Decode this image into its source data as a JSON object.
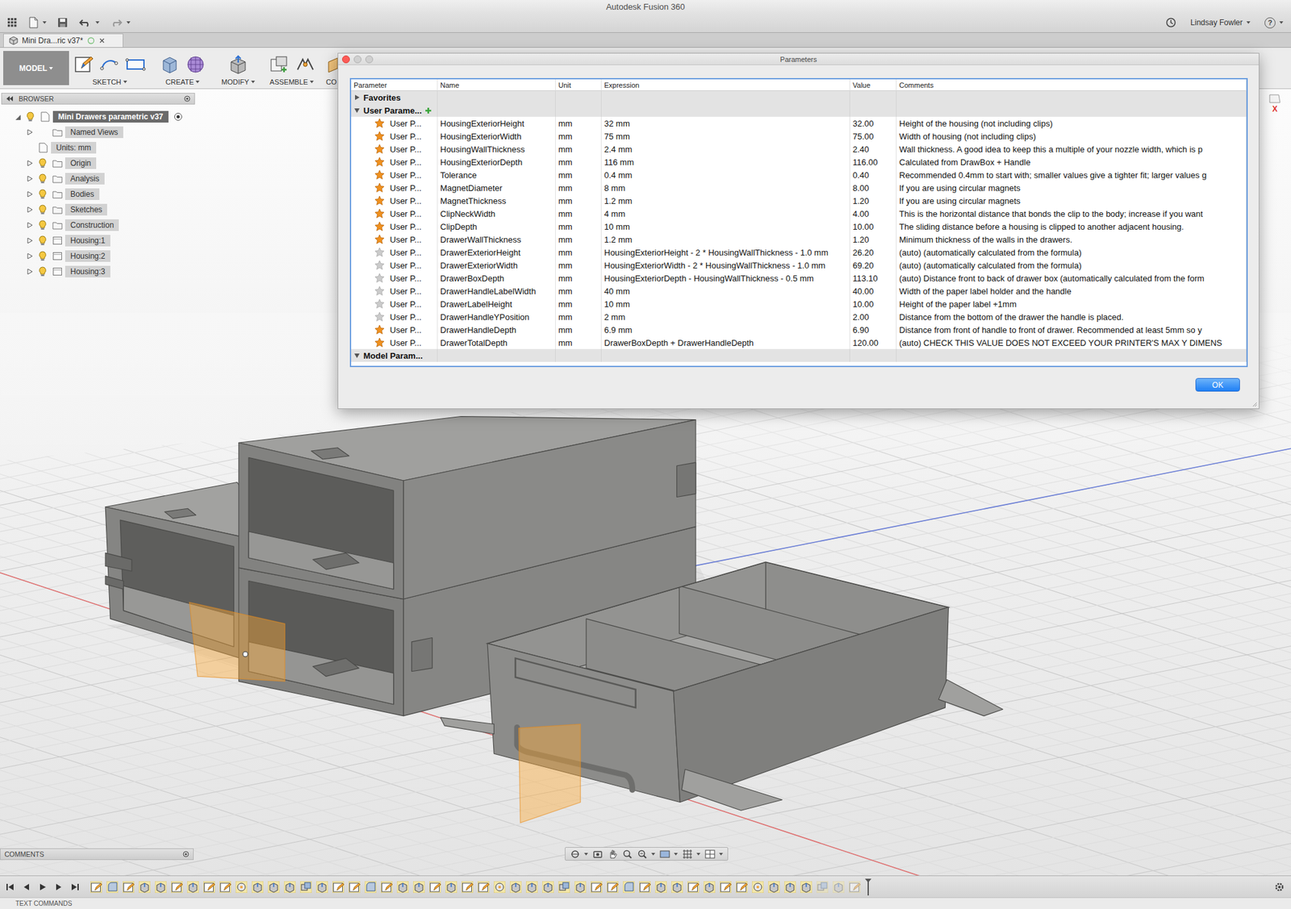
{
  "window": {
    "title": "Autodesk Fusion 360"
  },
  "app_bar": {
    "user": "Lindsay Fowler",
    "help": "?"
  },
  "document_tab": {
    "label": "Mini Dra...ric v37*",
    "selected": true
  },
  "toolbar": {
    "groups": [
      {
        "label": "MODEL",
        "kind": "workspace",
        "dropdown": true,
        "selected": true
      },
      {
        "label": "SKETCH",
        "kind": "sketch",
        "dropdown": true,
        "selected": false
      },
      {
        "label": "CREATE",
        "kind": "create",
        "dropdown": true,
        "selected": false
      },
      {
        "label": "MODIFY",
        "kind": "modify",
        "dropdown": true,
        "selected": false
      },
      {
        "label": "ASSEMBLE",
        "kind": "assemble",
        "dropdown": true,
        "selected": false
      },
      {
        "label": "CO",
        "kind": "construct",
        "dropdown": false,
        "selected": false
      }
    ]
  },
  "browser": {
    "title": "BROWSER",
    "items": [
      {
        "label": "Mini Drawers parametric v37",
        "kind": "root",
        "level": 0,
        "expandable": true,
        "expanded": true,
        "visible": true,
        "selected": true
      },
      {
        "label": "Named Views",
        "kind": "views",
        "level": 1,
        "expandable": true,
        "expanded": false,
        "selected": false
      },
      {
        "label": "Units: mm",
        "kind": "units",
        "level": 1,
        "expandable": false,
        "selected": false
      },
      {
        "label": "Origin",
        "kind": "folder",
        "level": 1,
        "expandable": true,
        "expanded": false,
        "visible": true,
        "selected": false
      },
      {
        "label": "Analysis",
        "kind": "folder",
        "level": 1,
        "expandable": true,
        "expanded": false,
        "visible": true,
        "selected": false
      },
      {
        "label": "Bodies",
        "kind": "folder",
        "level": 1,
        "expandable": true,
        "expanded": false,
        "visible": true,
        "selected": false
      },
      {
        "label": "Sketches",
        "kind": "folder",
        "level": 1,
        "expandable": true,
        "expanded": false,
        "visible": true,
        "selected": false
      },
      {
        "label": "Construction",
        "kind": "folder",
        "level": 1,
        "expandable": true,
        "expanded": false,
        "visible": true,
        "selected": false
      },
      {
        "label": "Housing:1",
        "kind": "component",
        "level": 1,
        "expandable": true,
        "expanded": false,
        "visible": true,
        "selected": false
      },
      {
        "label": "Housing:2",
        "kind": "component",
        "level": 1,
        "expandable": true,
        "expanded": false,
        "visible": true,
        "selected": false
      },
      {
        "label": "Housing:3",
        "kind": "component",
        "level": 1,
        "expandable": true,
        "expanded": false,
        "visible": true,
        "selected": false
      }
    ]
  },
  "viewcube": {
    "axis": "X"
  },
  "dialog": {
    "title": "Parameters",
    "columns": [
      "Parameter",
      "Name",
      "Unit",
      "Expression",
      "Value",
      "Comments"
    ],
    "groups": [
      {
        "label": "Favorites",
        "expanded": false,
        "add_button": false,
        "rows": []
      },
      {
        "label": "User Parame...",
        "expanded": true,
        "add_button": true,
        "rows": [
          {
            "type": "User P...",
            "name": "HousingExteriorHeight",
            "unit": "mm",
            "expression": "32 mm",
            "value": "32.00",
            "comment": "Height of the housing (not including clips)",
            "favorite": true
          },
          {
            "type": "User P...",
            "name": "HousingExteriorWidth",
            "unit": "mm",
            "expression": "75 mm",
            "value": "75.00",
            "comment": "Width of housing (not including clips)",
            "favorite": true
          },
          {
            "type": "User P...",
            "name": "HousingWallThickness",
            "unit": "mm",
            "expression": "2.4 mm",
            "value": "2.40",
            "comment": "Wall thickness. A good idea to keep this a multiple of your nozzle width, which is p",
            "favorite": true
          },
          {
            "type": "User P...",
            "name": "HousingExteriorDepth",
            "unit": "mm",
            "expression": "116 mm",
            "value": "116.00",
            "comment": "Calculated from DrawBox + Handle",
            "favorite": true
          },
          {
            "type": "User P...",
            "name": "Tolerance",
            "unit": "mm",
            "expression": "0.4 mm",
            "value": "0.40",
            "comment": "Recommended 0.4mm to start with; smaller values give a tighter fit; larger values g",
            "favorite": true
          },
          {
            "type": "User P...",
            "name": "MagnetDiameter",
            "unit": "mm",
            "expression": "8 mm",
            "value": "8.00",
            "comment": "If you are using circular magnets",
            "favorite": true
          },
          {
            "type": "User P...",
            "name": "MagnetThickness",
            "unit": "mm",
            "expression": "1.2 mm",
            "value": "1.20",
            "comment": "If you are using circular magnets",
            "favorite": true
          },
          {
            "type": "User P...",
            "name": "ClipNeckWidth",
            "unit": "mm",
            "expression": "4 mm",
            "value": "4.00",
            "comment": "This is the horizontal distance that bonds the clip to the body; increase if you want",
            "favorite": true
          },
          {
            "type": "User P...",
            "name": "ClipDepth",
            "unit": "mm",
            "expression": "10 mm",
            "value": "10.00",
            "comment": "The sliding distance before a housing is clipped to another adjacent housing.",
            "favorite": true
          },
          {
            "type": "User P...",
            "name": "DrawerWallThickness",
            "unit": "mm",
            "expression": "1.2 mm",
            "value": "1.20",
            "comment": "Minimum thickness of the walls in the drawers.",
            "favorite": true
          },
          {
            "type": "User P...",
            "name": "DrawerExteriorHeight",
            "unit": "mm",
            "expression": "HousingExteriorHeight - 2 * HousingWallThickness - 1.0 mm",
            "value": "26.20",
            "comment": "(auto) (automatically calculated from the formula)",
            "favorite": false
          },
          {
            "type": "User P...",
            "name": "DrawerExteriorWidth",
            "unit": "mm",
            "expression": "HousingExteriorWidth - 2 * HousingWallThickness - 1.0 mm",
            "value": "69.20",
            "comment": "(auto) (automatically calculated from the formula)",
            "favorite": false
          },
          {
            "type": "User P...",
            "name": "DrawerBoxDepth",
            "unit": "mm",
            "expression": "HousingExteriorDepth - HousingWallThickness - 0.5 mm",
            "value": "113.10",
            "comment": "(auto) Distance front to back of drawer box (automatically calculated from the form",
            "favorite": false
          },
          {
            "type": "User P...",
            "name": "DrawerHandleLabelWidth",
            "unit": "mm",
            "expression": "40 mm",
            "value": "40.00",
            "comment": "Width of the paper label holder and the handle",
            "favorite": false
          },
          {
            "type": "User P...",
            "name": "DrawerLabelHeight",
            "unit": "mm",
            "expression": "10 mm",
            "value": "10.00",
            "comment": "Height of the paper label +1mm",
            "favorite": false
          },
          {
            "type": "User P...",
            "name": "DrawerHandleYPosition",
            "unit": "mm",
            "expression": "2 mm",
            "value": "2.00",
            "comment": "Distance from the bottom of the drawer the handle is placed.",
            "favorite": false
          },
          {
            "type": "User P...",
            "name": "DrawerHandleDepth",
            "unit": "mm",
            "expression": "6.9 mm",
            "value": "6.90",
            "comment": "Distance from front of handle to front of drawer. Recommended at least 5mm so y",
            "favorite": true
          },
          {
            "type": "User P...",
            "name": "DrawerTotalDepth",
            "unit": "mm",
            "expression": "DrawerBoxDepth + DrawerHandleDepth",
            "value": "120.00",
            "comment": "(auto) CHECK THIS VALUE DOES NOT EXCEED YOUR PRINTER'S MAX Y DIMENS",
            "favorite": true
          }
        ]
      },
      {
        "label": "Model Param...",
        "expanded": true,
        "add_button": false,
        "rows": []
      }
    ],
    "buttons": [
      {
        "label": "OK",
        "selected": true
      }
    ]
  },
  "comments": {
    "title": "COMMENTS"
  },
  "status_bar": {
    "label": "TEXT COMMANDS"
  }
}
